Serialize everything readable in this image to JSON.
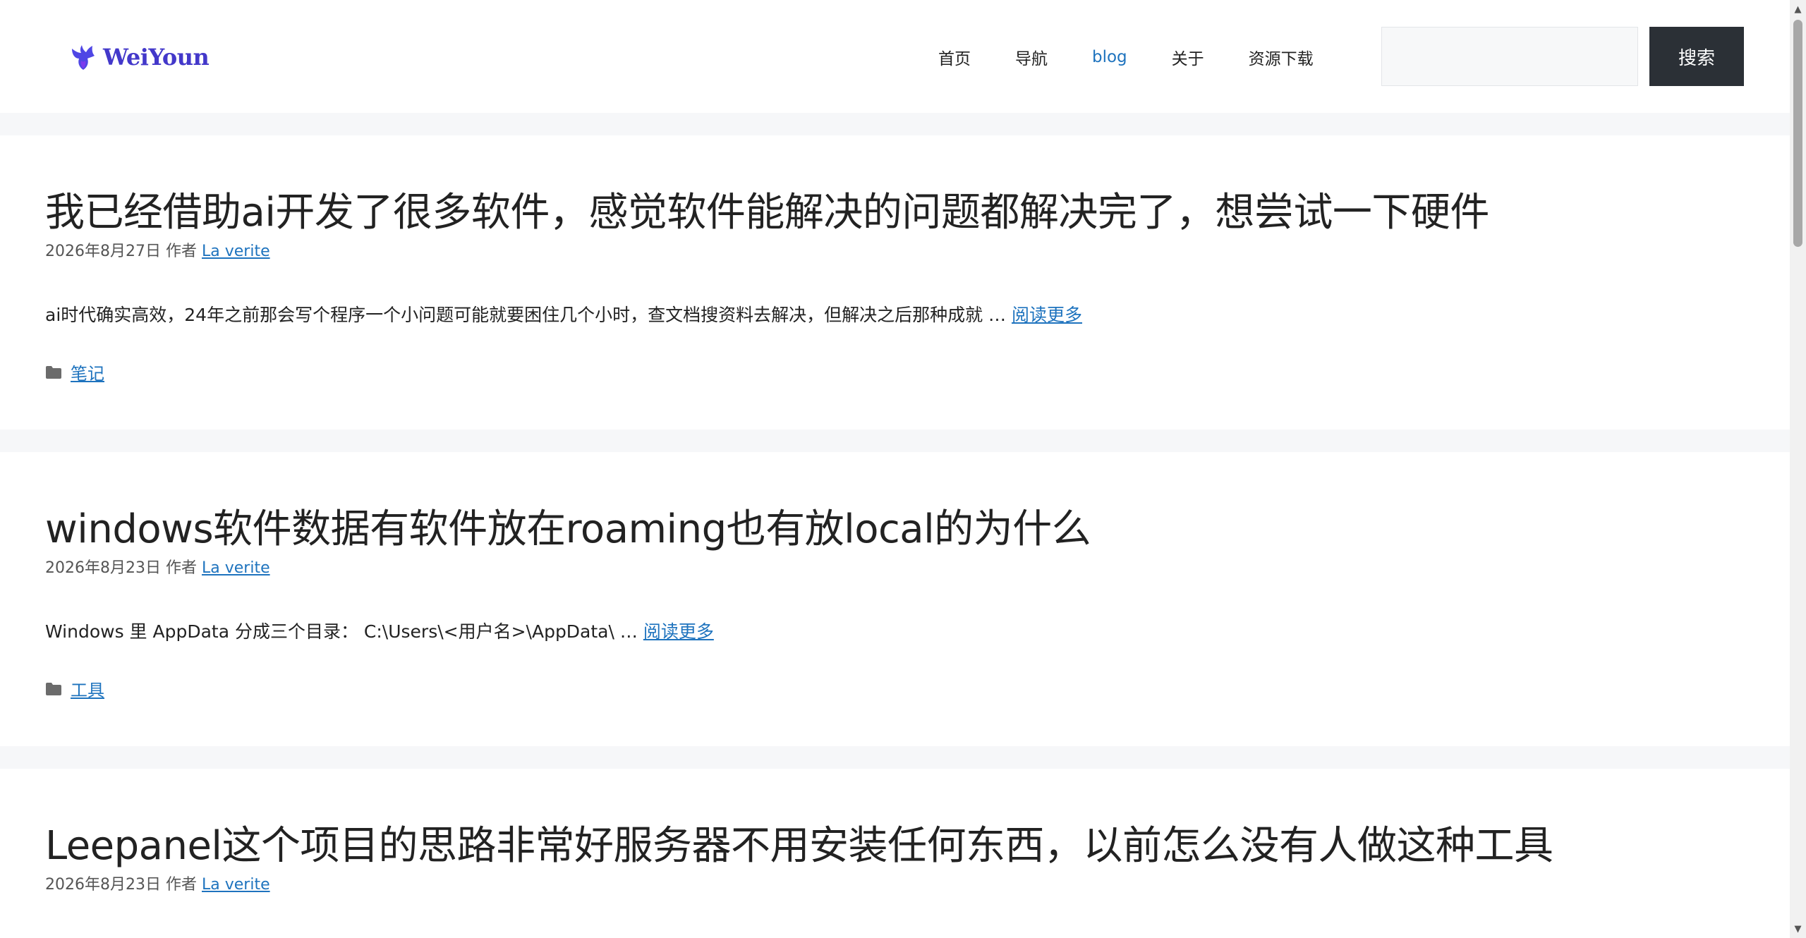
{
  "header": {
    "logo_text": "WeiYoun",
    "logo_icon": "phoenix-logo-icon",
    "nav": [
      {
        "label": "首页",
        "active": false
      },
      {
        "label": "导航",
        "active": false
      },
      {
        "label": "blog",
        "active": true
      },
      {
        "label": "关于",
        "active": false
      },
      {
        "label": "资源下载",
        "active": false
      }
    ],
    "search_placeholder": "",
    "search_button": "搜索"
  },
  "posts": [
    {
      "title": "我已经借助ai开发了很多软件，感觉软件能解决的问题都解决完了，想尝试一下硬件",
      "date": "2026年8月27日",
      "author_prefix": "作者",
      "author": "La verite",
      "excerpt": "ai时代确实高效，24年之前那会写个程序一个小问题可能就要困住几个小时，查文档搜资料去解决，但解决之后那种成就 … ",
      "read_more": "阅读更多",
      "category": "笔记"
    },
    {
      "title": "windows软件数据有软件放在roaming也有放local的为什么",
      "date": "2026年8月23日",
      "author_prefix": "作者",
      "author": "La verite",
      "excerpt": "Windows 里 AppData 分成三个目录： C:\\Users\\<用户名>\\AppData\\ … ",
      "read_more": "阅读更多",
      "category": "工具"
    },
    {
      "title": "Leepanel这个项目的思路非常好服务器不用安装任何东西，以前怎么没有人做这种工具",
      "date": "2026年8月23日",
      "author_prefix": "作者",
      "author": "La verite"
    }
  ],
  "colors": {
    "link": "#1e73be",
    "logo": "#4338ca",
    "button_bg": "#2b3036",
    "separator": "#f6f7f9"
  }
}
